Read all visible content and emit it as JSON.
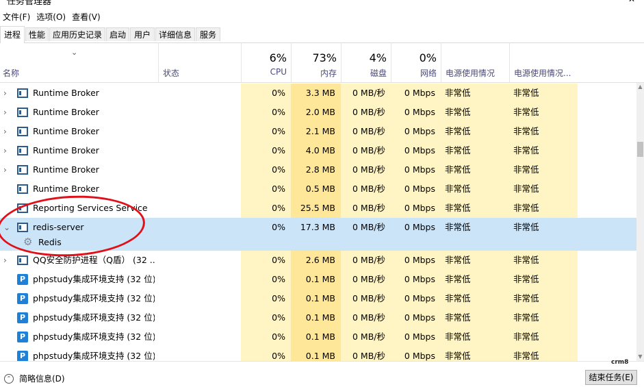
{
  "window": {
    "title": "任务管理器",
    "min_glyph": "—",
    "close_glyph": "✕"
  },
  "menu": [
    {
      "label": "文件(F)"
    },
    {
      "label": "选项(O)"
    },
    {
      "label": "查看(V)"
    }
  ],
  "tabs": [
    {
      "label": "进程",
      "active": true
    },
    {
      "label": "性能"
    },
    {
      "label": "应用历史记录"
    },
    {
      "label": "启动"
    },
    {
      "label": "用户"
    },
    {
      "label": "详细信息"
    },
    {
      "label": "服务"
    }
  ],
  "columns": {
    "name": "名称",
    "status": "状态",
    "cpu": {
      "pct": "6%",
      "label": "CPU"
    },
    "memory": {
      "pct": "73%",
      "label": "内存"
    },
    "disk": {
      "pct": "4%",
      "label": "磁盘"
    },
    "network": {
      "pct": "0%",
      "label": "网络"
    },
    "power": "电源使用情况",
    "power_trend": "电源使用情况..."
  },
  "processes": [
    {
      "name": "Runtime Broker",
      "icon": "app-window-icon",
      "expand": "›",
      "cpu": "0%",
      "memory": "3.3 MB",
      "disk": "0 MB/秒",
      "network": "0 Mbps",
      "power": "非常低",
      "power_trend": "非常低"
    },
    {
      "name": "Runtime Broker",
      "icon": "app-window-icon",
      "expand": "›",
      "cpu": "0%",
      "memory": "2.0 MB",
      "disk": "0 MB/秒",
      "network": "0 Mbps",
      "power": "非常低",
      "power_trend": "非常低"
    },
    {
      "name": "Runtime Broker",
      "icon": "app-window-icon",
      "expand": "›",
      "cpu": "0%",
      "memory": "2.1 MB",
      "disk": "0 MB/秒",
      "network": "0 Mbps",
      "power": "非常低",
      "power_trend": "非常低"
    },
    {
      "name": "Runtime Broker",
      "icon": "app-window-icon",
      "expand": "›",
      "cpu": "0%",
      "memory": "4.0 MB",
      "disk": "0 MB/秒",
      "network": "0 Mbps",
      "power": "非常低",
      "power_trend": "非常低"
    },
    {
      "name": "Runtime Broker",
      "icon": "app-window-icon",
      "expand": "›",
      "cpu": "0%",
      "memory": "2.8 MB",
      "disk": "0 MB/秒",
      "network": "0 Mbps",
      "power": "非常低",
      "power_trend": "非常低"
    },
    {
      "name": "Runtime Broker",
      "icon": "app-window-icon",
      "expand": "",
      "cpu": "0%",
      "memory": "0.5 MB",
      "disk": "0 MB/秒",
      "network": "0 Mbps",
      "power": "非常低",
      "power_trend": "非常低"
    },
    {
      "name": "Reporting Services Service",
      "icon": "app-window-icon",
      "expand": "",
      "cpu": "0%",
      "memory": "25.5 MB",
      "disk": "0 MB/秒",
      "network": "0 Mbps",
      "power": "非常低",
      "power_trend": "非常低"
    },
    {
      "name": "redis-server",
      "icon": "app-window-icon",
      "expand": "⌄",
      "selected": true,
      "cpu": "0%",
      "memory": "17.3 MB",
      "disk": "0 MB/秒",
      "network": "0 Mbps",
      "power": "非常低",
      "power_trend": "非常低",
      "child": {
        "name": "Redis",
        "icon": "gear-icon"
      }
    },
    {
      "name": "QQ安全防护进程（Q盾） (32 ...",
      "icon": "app-window-icon",
      "expand": "›",
      "cpu": "0%",
      "memory": "2.6 MB",
      "disk": "0 MB/秒",
      "network": "0 Mbps",
      "power": "非常低",
      "power_trend": "非常低"
    },
    {
      "name": "phpstudy集成环境支持 (32 位)",
      "icon": "phpstudy-icon",
      "expand": "",
      "cpu": "0%",
      "memory": "0.1 MB",
      "disk": "0 MB/秒",
      "network": "0 Mbps",
      "power": "非常低",
      "power_trend": "非常低"
    },
    {
      "name": "phpstudy集成环境支持 (32 位)",
      "icon": "phpstudy-icon",
      "expand": "",
      "cpu": "0%",
      "memory": "0.1 MB",
      "disk": "0 MB/秒",
      "network": "0 Mbps",
      "power": "非常低",
      "power_trend": "非常低"
    },
    {
      "name": "phpstudy集成环境支持 (32 位)",
      "icon": "phpstudy-icon",
      "expand": "",
      "cpu": "0%",
      "memory": "0.1 MB",
      "disk": "0 MB/秒",
      "network": "0 Mbps",
      "power": "非常低",
      "power_trend": "非常低"
    },
    {
      "name": "phpstudy集成环境支持 (32 位)",
      "icon": "phpstudy-icon",
      "expand": "",
      "cpu": "0%",
      "memory": "0.1 MB",
      "disk": "0 MB/秒",
      "network": "0 Mbps",
      "power": "非常低",
      "power_trend": "非常低"
    },
    {
      "name": "phpstudy集成环境支持 (32 位)",
      "icon": "phpstudy-icon",
      "expand": "",
      "cpu": "0%",
      "memory": "0.1 MB",
      "disk": "0 MB/秒",
      "network": "0 Mbps",
      "power": "非常低",
      "power_trend": "非常低"
    }
  ],
  "footer": {
    "less_details": "简略信息(D)",
    "end_task": "结束任务(E)"
  },
  "watermark": "crm8"
}
